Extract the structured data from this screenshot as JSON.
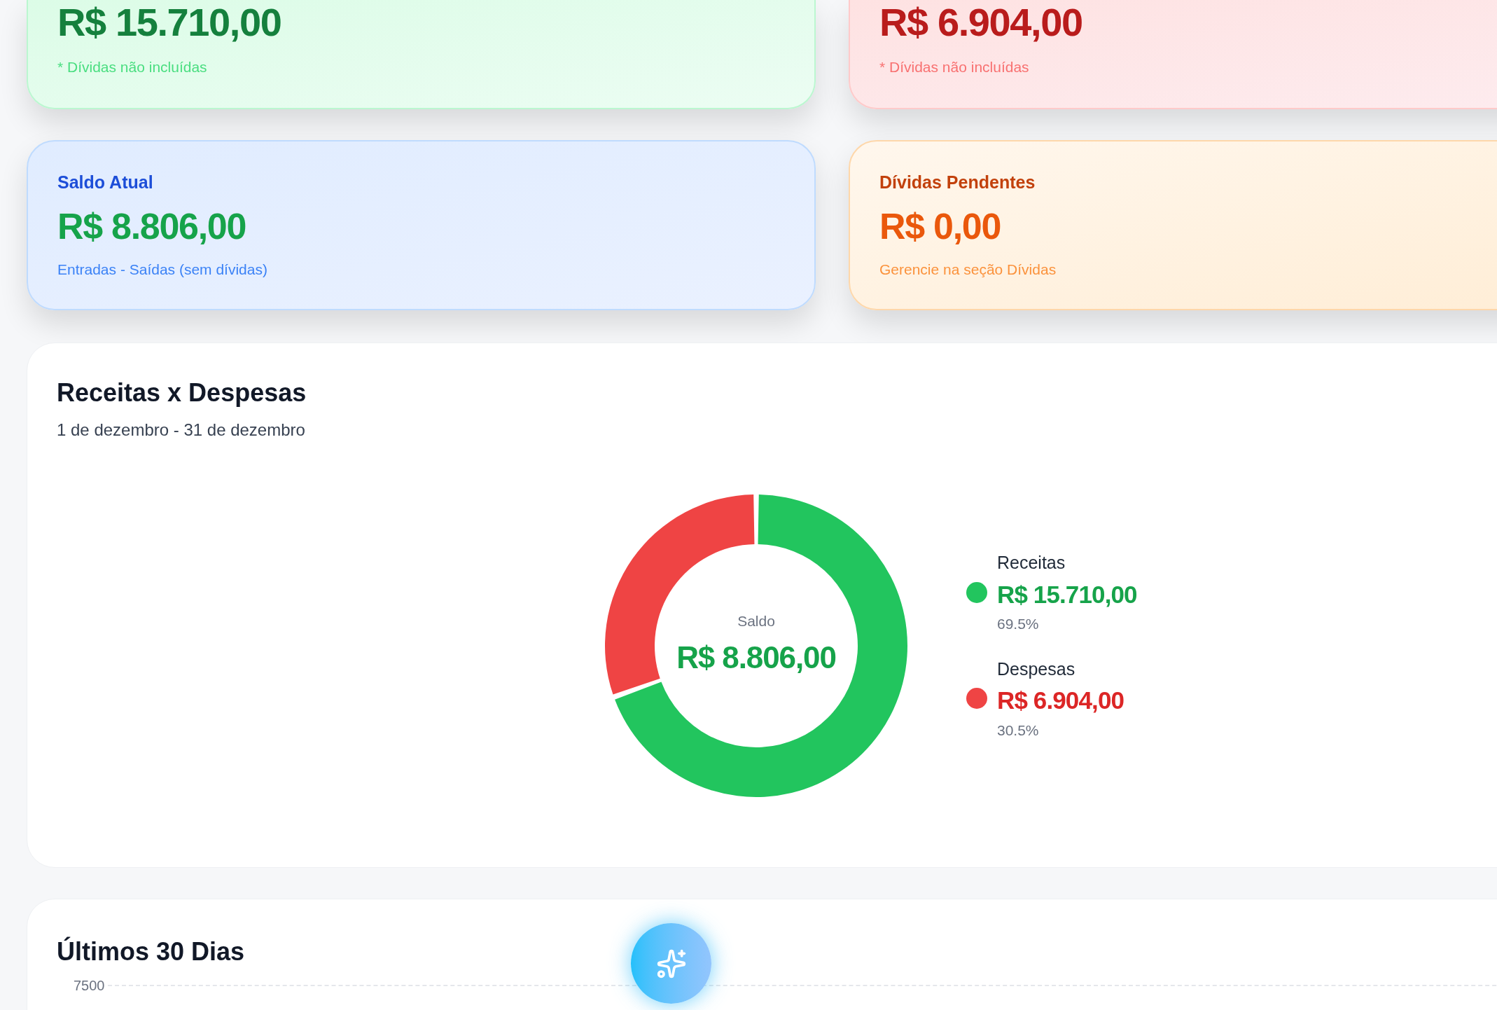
{
  "summary_cards": [
    {
      "kind": "income",
      "amount": "R$ 15.710,00",
      "note": "* Dívidas não incluídas"
    },
    {
      "kind": "expense",
      "amount": "R$ 6.904,00",
      "note": "* Dívidas não incluídas"
    },
    {
      "kind": "balance",
      "title": "Saldo Atual",
      "amount": "R$ 8.806,00",
      "note": "Entradas - Saídas (sem dívidas)"
    },
    {
      "kind": "debt",
      "title": "Dívidas Pendentes",
      "amount": "R$ 0,00",
      "note": "Gerencie na seção Dívidas"
    }
  ],
  "income_expense_panel": {
    "subtitle": "1 de dezembro - 31 de dezembro",
    "center_label": "Saldo",
    "center_value": "R$ 8.806,00",
    "legend": [
      {
        "kind": "income",
        "value": "R$ 15.710,00",
        "percent": "69.5%",
        "color": "#22c55e"
      },
      {
        "kind": "expense",
        "value": "R$ 6.904,00",
        "percent": "30.5%",
        "color": "#ef4444"
      }
    ],
    "chart_data": {
      "type": "donut",
      "categories": [
        "Receitas",
        "Despesas"
      ],
      "series": [
        {
          "name": "Receitas x Despesas",
          "values": [
            69.5,
            30.5
          ]
        }
      ]
    }
  },
  "recent_panel": {
    "title": "Últimos 30 Dias",
    "y_tick": "7500"
  }
}
